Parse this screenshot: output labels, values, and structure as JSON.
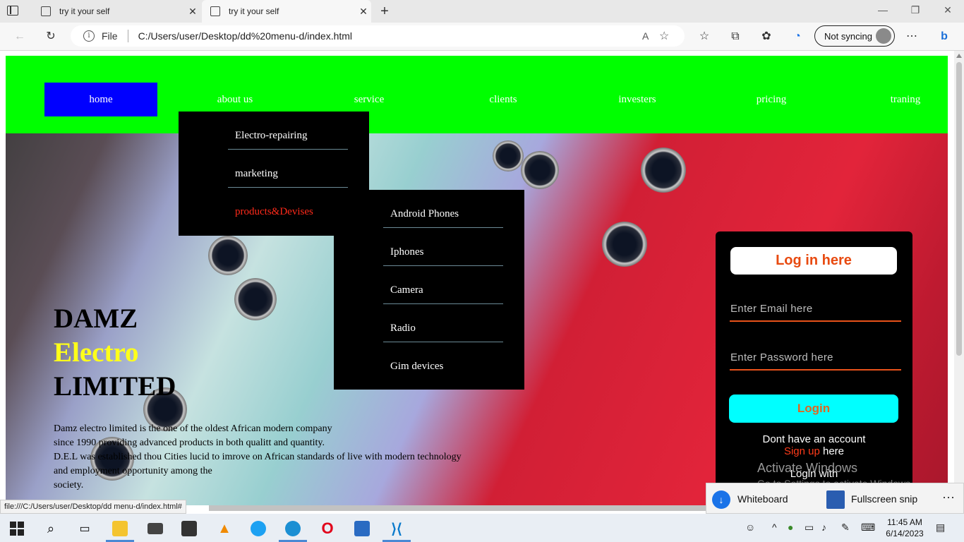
{
  "browser": {
    "tabs": [
      {
        "title": "try it your self",
        "active": false
      },
      {
        "title": "try it your self",
        "active": true
      }
    ],
    "address": {
      "scheme_label": "File",
      "url": "C:/Users/user/Desktop/dd%20menu-d/index.html"
    },
    "sync_label": "Not syncing",
    "status_url": "file:///C:/Users/user/Desktop/dd menu-d/index.html#"
  },
  "nav": {
    "items": [
      "home",
      "about us",
      "service",
      "clients",
      "investers",
      "pricing",
      "traning"
    ]
  },
  "dropdown_service": {
    "items": [
      "Electro-repairing",
      "marketing",
      "products&Devises"
    ],
    "highlight_color": "#ff2a1a"
  },
  "dropdown_products": {
    "items": [
      "Android Phones",
      "Iphones",
      "Camera",
      "Radio",
      "Gim devices"
    ]
  },
  "hero": {
    "title_line1": "DAMZ",
    "title_line2": "Electro",
    "title_line3": "LIMITED",
    "text_line1": "Damz electro limited is the one of the oldest African modern company",
    "text_line2": "since 1990 providing advanced products in both qualitt and quantity.",
    "text_line3": "D.E.L was established thou Cities lucid to imrove on African standards of live with modern technology",
    "text_line4": "and employment opportunity among the",
    "text_line5": "society."
  },
  "login": {
    "title": "Log in here",
    "email_placeholder": "Enter Email here",
    "password_placeholder": "Enter Password here",
    "button": "Login",
    "no_account": "Dont have an account",
    "signup": "Sign up",
    "here": "here",
    "login_with": "Login with"
  },
  "watermark": {
    "line1": "Activate Windows",
    "line2": "Go to Settings to activate Windows."
  },
  "notification": {
    "item1": "Whiteboard",
    "item2": "Fullscreen snip"
  },
  "taskbar": {
    "time": "11:45 AM",
    "date": "6/14/2023"
  },
  "colors": {
    "nav_bg": "#00ff00",
    "nav_active": "#0000ff",
    "login_accent": "#e8521a",
    "login_button": "#00ffff",
    "title_yellow": "#ffff1a"
  }
}
